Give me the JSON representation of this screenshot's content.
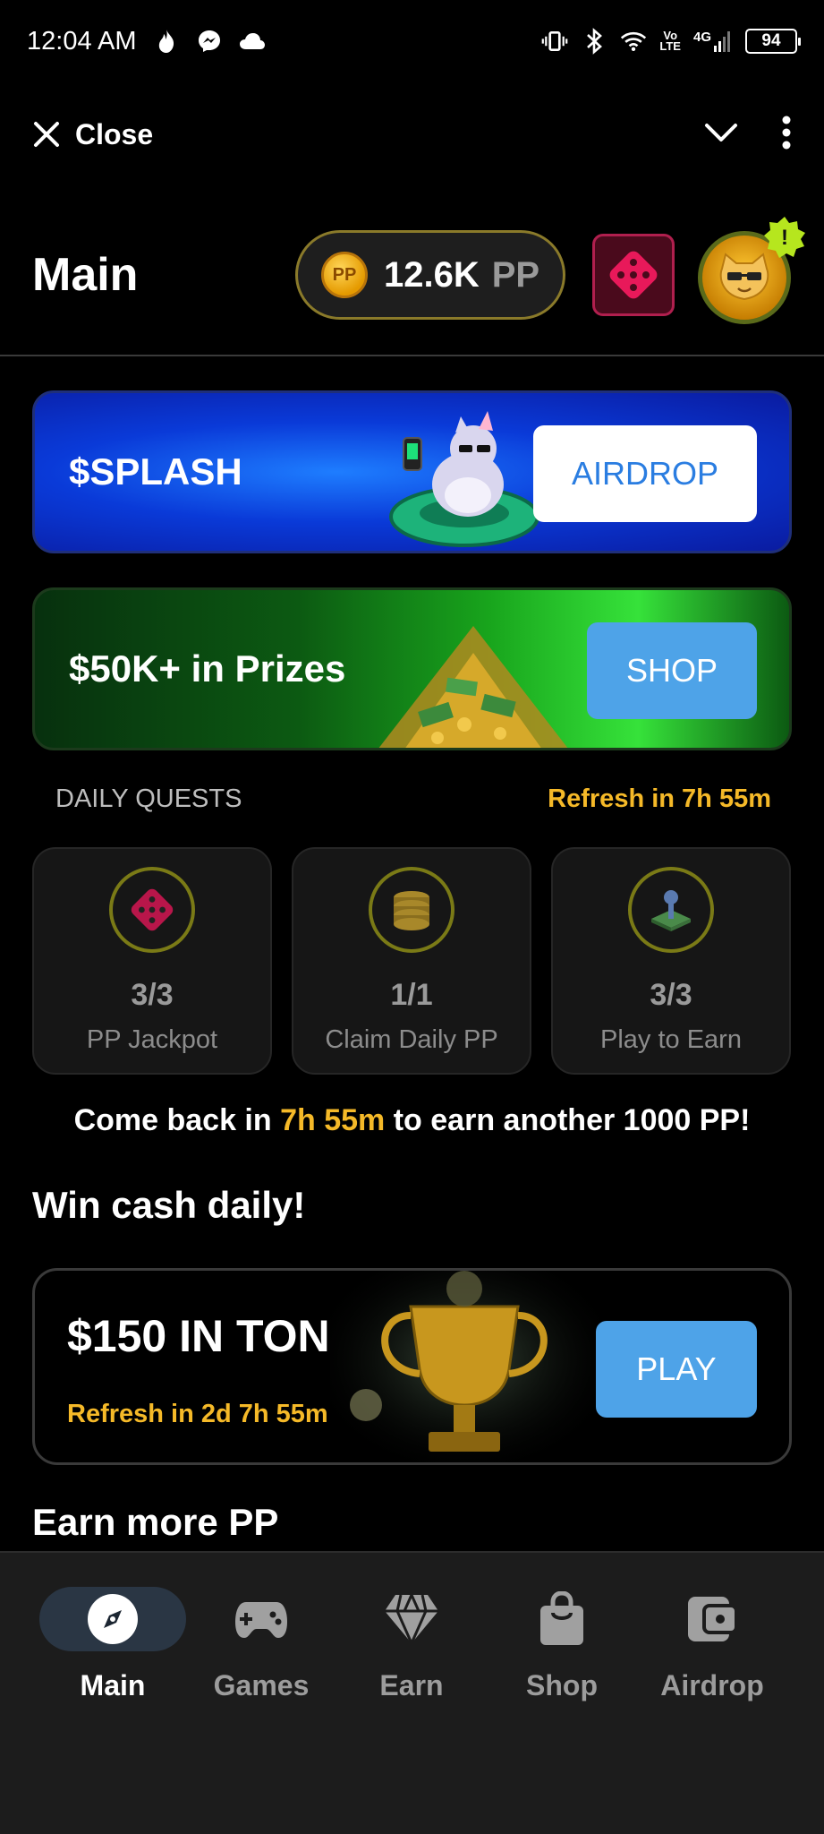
{
  "status_bar": {
    "time": "12:04 AM",
    "network_vo": "Vo",
    "network_lte": "LTE",
    "network_4g": "4G",
    "battery": "94"
  },
  "top_bar": {
    "close_label": "Close"
  },
  "header": {
    "title": "Main",
    "coin_label": "PP",
    "balance": "12.6K",
    "balance_unit": "PP",
    "alert_mark": "!"
  },
  "banners": [
    {
      "title": "$SPLASH",
      "button": "AIRDROP"
    },
    {
      "title": "$50K+ in Prizes",
      "button": "SHOP"
    }
  ],
  "daily_quests": {
    "label": "DAILY QUESTS",
    "refresh": "Refresh in 7h 55m",
    "items": [
      {
        "count": "3/3",
        "name": "PP Jackpot",
        "icon": "dice-icon"
      },
      {
        "count": "1/1",
        "name": "Claim Daily PP",
        "icon": "coin-stack-icon"
      },
      {
        "count": "3/3",
        "name": "Play to Earn",
        "icon": "joystick-icon"
      }
    ]
  },
  "comeback": {
    "prefix": "Come back in ",
    "time": "7h 55m",
    "suffix": " to earn another 1000 PP!"
  },
  "win_cash": {
    "section_title": "Win cash daily!",
    "prize": "$150 IN TON",
    "refresh": "Refresh in 2d 7h 55m",
    "button": "PLAY"
  },
  "earn_more": {
    "section_title": "Earn more PP"
  },
  "bottom_nav": {
    "items": [
      {
        "label": "Main",
        "icon": "compass-icon",
        "active": true
      },
      {
        "label": "Games",
        "icon": "gamepad-icon",
        "active": false
      },
      {
        "label": "Earn",
        "icon": "diamond-icon",
        "active": false
      },
      {
        "label": "Shop",
        "icon": "shopping-bag-icon",
        "active": false
      },
      {
        "label": "Airdrop",
        "icon": "wallet-icon",
        "active": false
      }
    ]
  },
  "colors": {
    "accent_yellow": "#f5b928",
    "button_blue": "#4ea3e8",
    "dice_pink": "#e8195a"
  }
}
